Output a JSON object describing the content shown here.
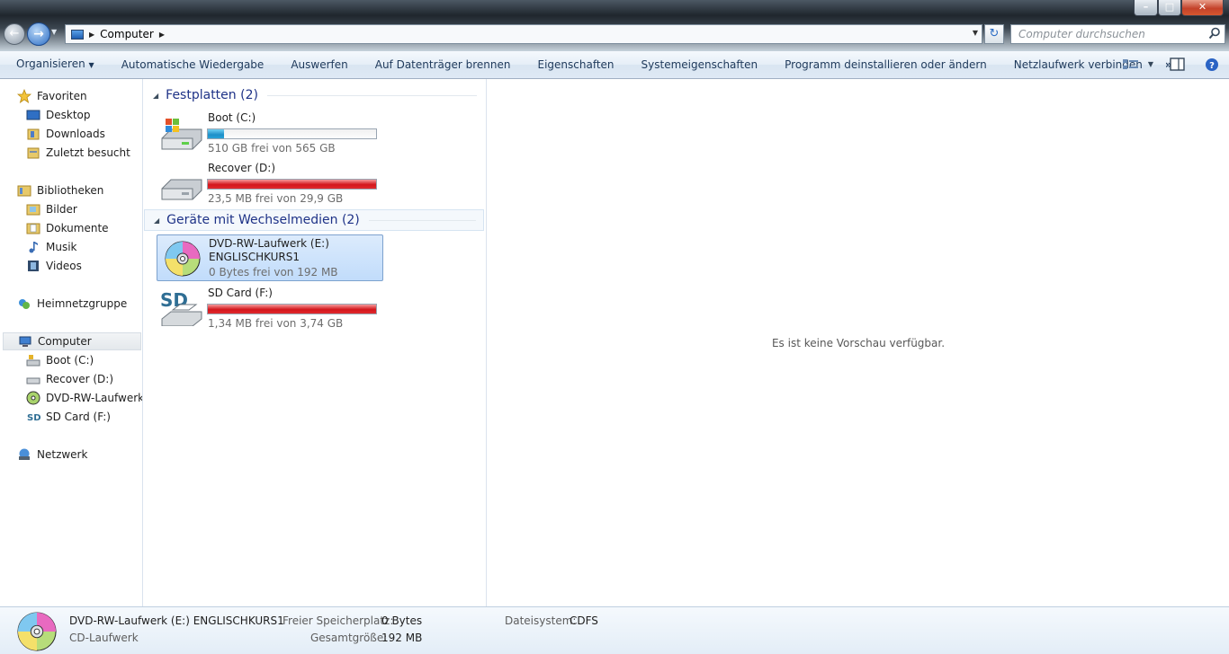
{
  "address": {
    "location": "Computer"
  },
  "search": {
    "placeholder": "Computer durchsuchen"
  },
  "toolbar": {
    "items": [
      "Organisieren",
      "Automatische Wiedergabe",
      "Auswerfen",
      "Auf Datenträger brennen",
      "Eigenschaften",
      "Systemeigenschaften",
      "Programm deinstallieren oder ändern",
      "Netzlaufwerk verbinden"
    ],
    "more": "»"
  },
  "nav": {
    "favorites": "Favoriten",
    "desktop": "Desktop",
    "downloads": "Downloads",
    "recent": "Zuletzt besucht",
    "libraries": "Bibliotheken",
    "pictures": "Bilder",
    "documents": "Dokumente",
    "music": "Musik",
    "videos": "Videos",
    "homegroup": "Heimnetzgruppe",
    "computer": "Computer",
    "boot": "Boot (C:)",
    "recover": "Recover (D:)",
    "dvd": "DVD-RW-Laufwerk (",
    "sd": "SD Card (F:)",
    "network": "Netzwerk"
  },
  "groups": {
    "hdd": "Festplatten (2)",
    "removable": "Geräte mit Wechselmedien (2)"
  },
  "drives": {
    "boot": {
      "name": "Boot (C:)",
      "free": "510 GB frei von 565 GB",
      "used_fraction": 0.097
    },
    "recover": {
      "name": "Recover (D:)",
      "free": "23,5 MB frei von 29,9 GB",
      "used_fraction": 0.999
    },
    "dvd": {
      "name": "DVD-RW-Laufwerk (E:)",
      "label": "ENGLISCHKURS1",
      "free": "0 Bytes frei von 192 MB"
    },
    "sd": {
      "name": "SD Card (F:)",
      "free": "1,34 MB frei von 3,74 GB",
      "used_fraction": 0.999
    }
  },
  "preview": {
    "message": "Es ist keine Vorschau verfügbar."
  },
  "details": {
    "title": "DVD-RW-Laufwerk (E:) ENGLISCHKURS1",
    "type": "CD-Laufwerk",
    "free_label": "Freier Speicherplatz:",
    "free_value": "0 Bytes",
    "total_label": "Gesamtgröße:",
    "total_value": "192 MB",
    "fs_label": "Dateisystem:",
    "fs_value": "CDFS"
  },
  "colors": {
    "accent_blue": "#1e3287",
    "bar_blue": "#1e8fc8",
    "bar_red": "#d3161c"
  }
}
